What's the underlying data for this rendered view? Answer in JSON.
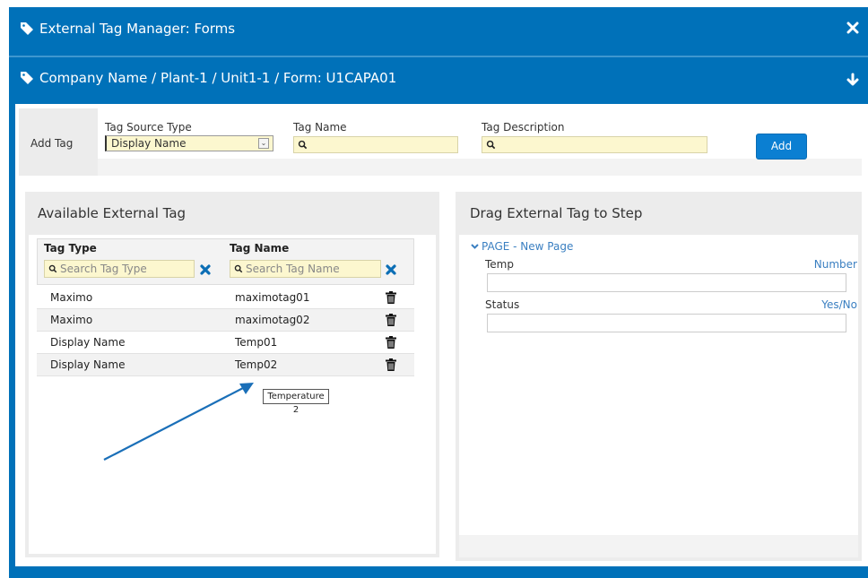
{
  "window": {
    "title": "External Tag Manager: Forms",
    "close_icon": "close-x-icon"
  },
  "path": {
    "title": "Company Name / Plant-1 / Unit1-1 / Form: U1CAPA01",
    "expand_icon": "arrow-down-icon"
  },
  "add_tag": {
    "label": "Add Tag",
    "source_type_label": "Tag Source Type",
    "source_type_value": "Display Name",
    "tag_name_label": "Tag Name",
    "tag_name_value": "",
    "tag_description_label": "Tag Description",
    "tag_description_value": "",
    "add_button": "Add"
  },
  "available": {
    "title": "Available External Tag",
    "col_type": "Tag Type",
    "col_name": "Tag Name",
    "search_type_placeholder": "Search Tag Type",
    "search_name_placeholder": "Search Tag Name",
    "rows": [
      {
        "type": "Maximo",
        "name": "maximotag01"
      },
      {
        "type": "Maximo",
        "name": "maximotag02"
      },
      {
        "type": "Display Name",
        "name": "Temp01"
      },
      {
        "type": "Display Name",
        "name": "Temp02"
      }
    ],
    "tooltip": "Temperature 2"
  },
  "drag": {
    "title": "Drag External Tag to Step",
    "page_link": "PAGE - New Page",
    "steps": [
      {
        "label": "Temp",
        "type": "Number"
      },
      {
        "label": "Status",
        "type": "Yes/No"
      }
    ]
  },
  "colors": {
    "brand_blue": "#0071b9",
    "button_blue": "#0b7fd2",
    "input_yellow": "#fcf7cf",
    "link_blue": "#3a7fc1"
  }
}
